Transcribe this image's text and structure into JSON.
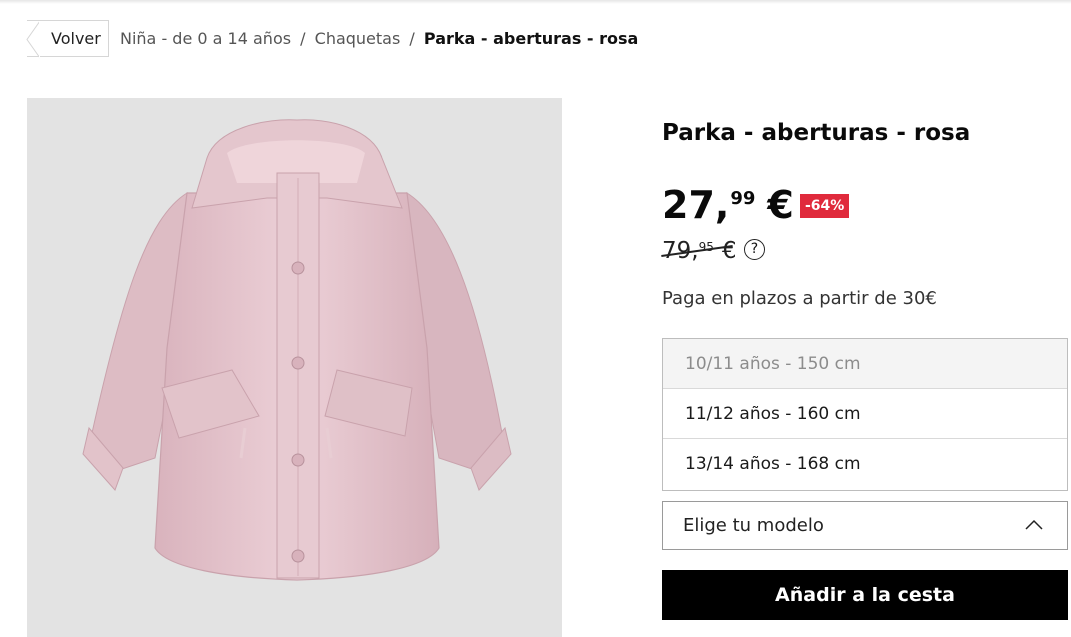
{
  "breadcrumb": {
    "back_label": "Volver",
    "items": [
      "Niña - de 0 a 14 años",
      "Chaquetas"
    ],
    "separator": "/",
    "current": "Parka - aberturas - rosa"
  },
  "product": {
    "image_icon": "pink-parka-photo",
    "title": "Parka - aberturas - rosa",
    "price_int": "27,",
    "price_cents": "99",
    "currency": "€",
    "discount": "-64%",
    "old_price_int": "79,",
    "old_price_cents": "95",
    "help_icon": "question-circle-icon",
    "help_glyph": "?",
    "installments": "Paga en plazos a partir de 30€"
  },
  "size_options": [
    {
      "label": "10/11 años - 150 cm",
      "disabled": true
    },
    {
      "label": "11/12 años - 160 cm",
      "disabled": false
    },
    {
      "label": "13/14 años - 168 cm",
      "disabled": false
    }
  ],
  "model_select": {
    "label": "Elige tu modelo",
    "icon": "chevron-up-icon"
  },
  "cart_button": "Añadir a la cesta",
  "colors": {
    "discount_bg": "#e02a3c",
    "button_bg": "#000000",
    "image_bg": "#e3e3e3",
    "parka_pink": "#e6c7cf"
  }
}
